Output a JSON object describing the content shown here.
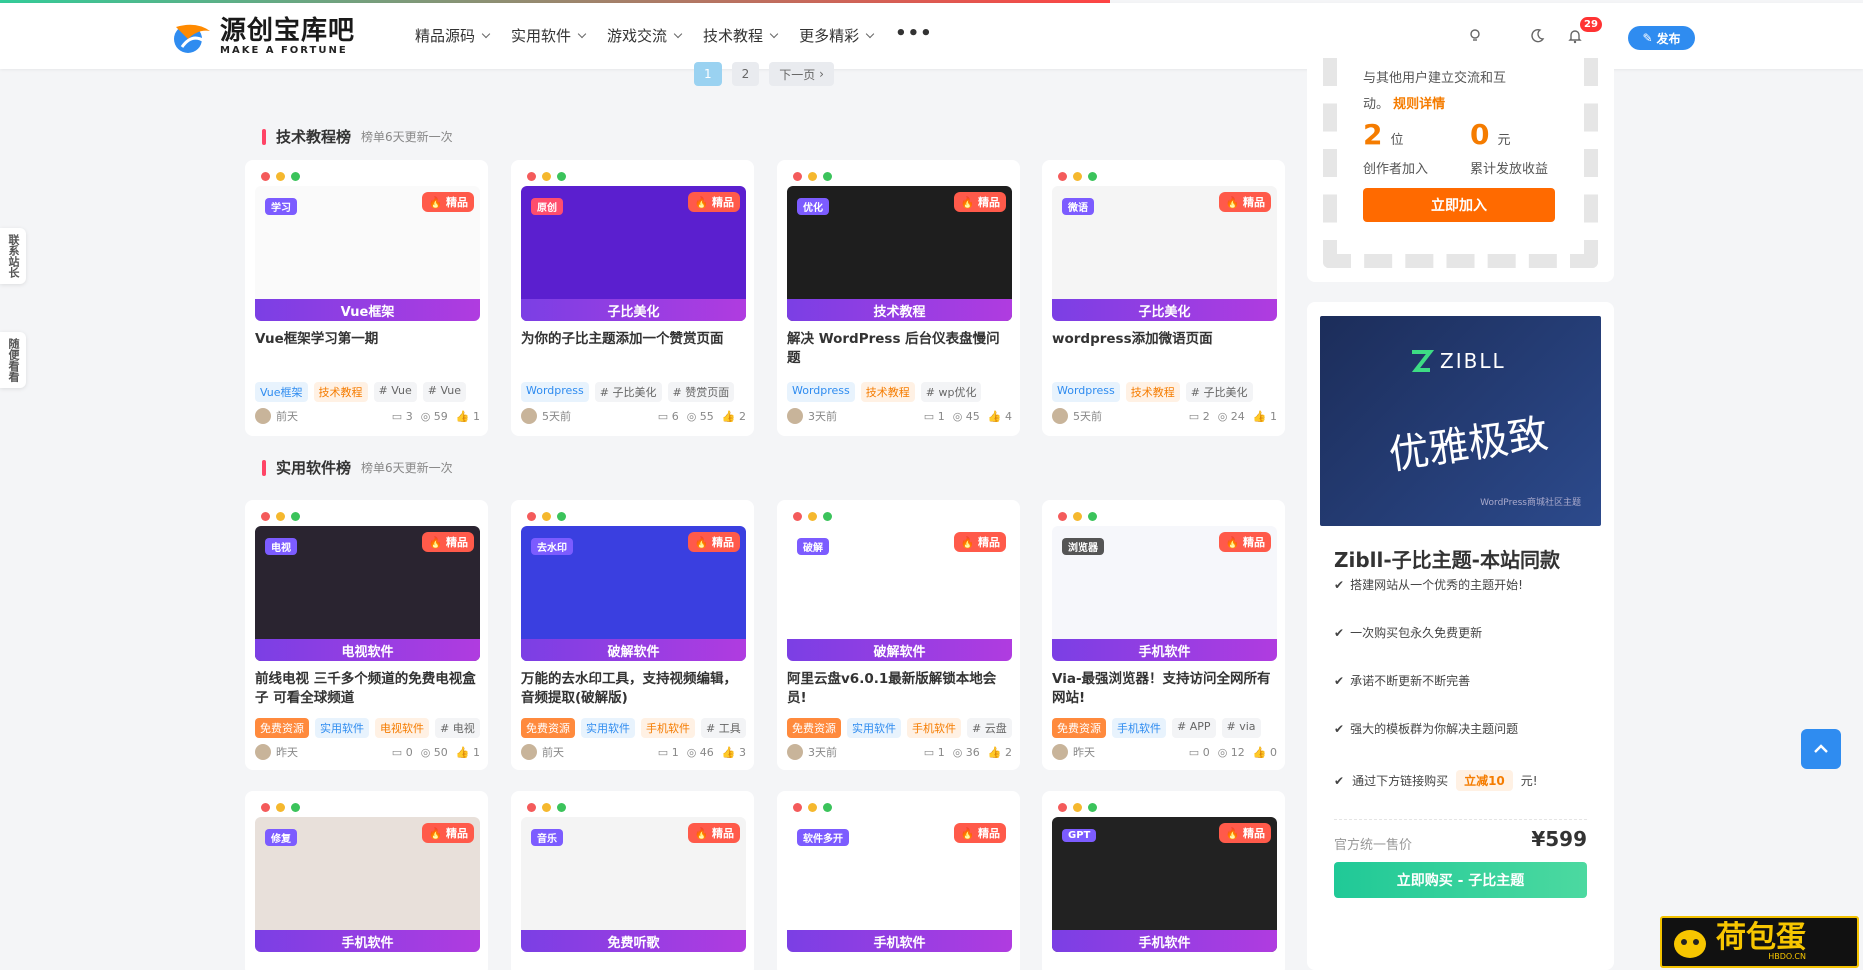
{
  "header": {
    "logo_cn": "源创宝库吧",
    "logo_en": "MAKE A FORTUNE",
    "nav": [
      "精品源码",
      "实用软件",
      "游戏交流",
      "技术教程",
      "更多精彩"
    ],
    "more": "•••",
    "notify_count": "29",
    "publish": "发布"
  },
  "pager": {
    "p1": "1",
    "p2": "2",
    "next": "下一页"
  },
  "sections": [
    {
      "title": "技术教程榜",
      "sub": "榜单6天更新一次"
    },
    {
      "title": "实用软件榜",
      "sub": "榜单6天更新一次"
    }
  ],
  "hot_label": "精品",
  "cards_row1": [
    {
      "cat": "学习",
      "cat_color": "#7c5cff",
      "bottom": "Vue框架",
      "title": "Vue框架学习第一期",
      "tags": [
        {
          "t": "Vue框架",
          "c": "blue"
        },
        {
          "t": "技术教程",
          "c": "orange"
        },
        {
          "t": "# Vue",
          "c": ""
        },
        {
          "t": "# Vue",
          "c": ""
        }
      ],
      "time": "前天",
      "comments": "3",
      "views": "59",
      "likes": "1",
      "bg": "#fafafa"
    },
    {
      "cat": "原创",
      "cat_color": "#ff4d6d",
      "bottom": "子比美化",
      "title": "为你的子比主题添加一个赞赏页面",
      "tags": [
        {
          "t": "Wordpress",
          "c": "blue"
        },
        {
          "t": "# 子比美化",
          "c": ""
        },
        {
          "t": "# 赞赏页面",
          "c": ""
        }
      ],
      "time": "5天前",
      "comments": "6",
      "views": "55",
      "likes": "2",
      "bg": "#5b1fcf"
    },
    {
      "cat": "优化",
      "cat_color": "#7c5cff",
      "bottom": "技术教程",
      "title": "解决 WordPress 后台仪表盘慢问题",
      "tags": [
        {
          "t": "Wordpress",
          "c": "blue"
        },
        {
          "t": "技术教程",
          "c": "orange"
        },
        {
          "t": "# wp优化",
          "c": ""
        }
      ],
      "time": "3天前",
      "comments": "1",
      "views": "45",
      "likes": "4",
      "bg": "#1e1e1e"
    },
    {
      "cat": "微语",
      "cat_color": "#7c5cff",
      "bottom": "子比美化",
      "title": "wordpress添加微语页面",
      "tags": [
        {
          "t": "Wordpress",
          "c": "blue"
        },
        {
          "t": "技术教程",
          "c": "orange"
        },
        {
          "t": "# 子比美化",
          "c": ""
        }
      ],
      "time": "5天前",
      "comments": "2",
      "views": "24",
      "likes": "1",
      "bg": "#f5f5f5"
    }
  ],
  "cards_row2": [
    {
      "cat": "电视",
      "cat_color": "#7c5cff",
      "bottom": "电视软件",
      "title": "前线电视 三千多个频道的免费电视盒子 可看全球频道",
      "tags": [
        {
          "t": "免费资源",
          "c": "free"
        },
        {
          "t": "实用软件",
          "c": "blue"
        },
        {
          "t": "电视软件",
          "c": "orange"
        },
        {
          "t": "# 电视",
          "c": ""
        }
      ],
      "time": "昨天",
      "comments": "0",
      "views": "50",
      "likes": "1",
      "bg": "#2a2430"
    },
    {
      "cat": "去水印",
      "cat_color": "#7c5cff",
      "bottom": "破解软件",
      "title": "万能的去水印工具，支持视频编辑，音频提取(破解版)",
      "tags": [
        {
          "t": "免费资源",
          "c": "free"
        },
        {
          "t": "实用软件",
          "c": "blue"
        },
        {
          "t": "手机软件",
          "c": "orange"
        },
        {
          "t": "# 工具",
          "c": ""
        }
      ],
      "time": "前天",
      "comments": "1",
      "views": "46",
      "likes": "3",
      "bg": "#3a3fe0"
    },
    {
      "cat": "破解",
      "cat_color": "#7c5cff",
      "bottom": "破解软件",
      "title": "阿里云盘v6.0.1最新版解锁本地会员!",
      "tags": [
        {
          "t": "免费资源",
          "c": "free"
        },
        {
          "t": "实用软件",
          "c": "blue"
        },
        {
          "t": "手机软件",
          "c": "orange"
        },
        {
          "t": "# 云盘",
          "c": ""
        }
      ],
      "time": "3天前",
      "comments": "1",
      "views": "36",
      "likes": "2",
      "bg": "#ffffff"
    },
    {
      "cat": "浏览器",
      "cat_color": "#555",
      "bottom": "手机软件",
      "title": "Via-最强浏览器！支持访问全网所有网站!",
      "tags": [
        {
          "t": "免费资源",
          "c": "free"
        },
        {
          "t": "手机软件",
          "c": "blue"
        },
        {
          "t": "# APP",
          "c": ""
        },
        {
          "t": "# via",
          "c": ""
        }
      ],
      "time": "昨天",
      "comments": "0",
      "views": "12",
      "likes": "0",
      "bg": "#f6f7fb"
    }
  ],
  "cards_row3": [
    {
      "cat": "修复",
      "cat_color": "#7c5cff",
      "bottom": "手机软件",
      "bg": "#e8e0da"
    },
    {
      "cat": "音乐",
      "cat_color": "#7c5cff",
      "bottom": "免费听歌",
      "bg": "#f4f4f4"
    },
    {
      "cat": "软件多开",
      "cat_color": "#7c5cff",
      "bottom": "手机软件",
      "bg": "#ffffff"
    },
    {
      "cat": "GPT",
      "cat_color": "#7c5cff",
      "bottom": "手机软件",
      "bg": "#222"
    }
  ],
  "creator_widget": {
    "text1": "与其他用户建立交流和互",
    "text2": "动。",
    "rules_link": "规则详情",
    "creators_num": "2",
    "creators_unit": "位",
    "creators_label": "创作者加入",
    "earnings_num": "0",
    "earnings_unit": "元",
    "earnings_label": "累计发放收益",
    "join_button": "立即加入"
  },
  "product_widget": {
    "banner_brand": "ZIBLL",
    "banner_slogan": "优雅极致",
    "banner_small": "WordPress商城社区主题",
    "title": "Zibll-子比主题-本站同款",
    "features": [
      "搭建网站从一个优秀的主题开始!",
      "一次购买包永久免费更新",
      "承诺不断更新不断完善",
      "强大的模板群为你解决主题问题"
    ],
    "discount_prefix": "通过下方链接购买",
    "discount_value": "立减10",
    "discount_suffix": "元!",
    "price_label": "官方统一售价",
    "price": "¥599",
    "buy_button": "立即购买 - 子比主题"
  },
  "float_left": {
    "contact": "联系站长",
    "random": "随便看看"
  },
  "watermark": "荷包蛋",
  "watermark_url": "HBDO.CN"
}
